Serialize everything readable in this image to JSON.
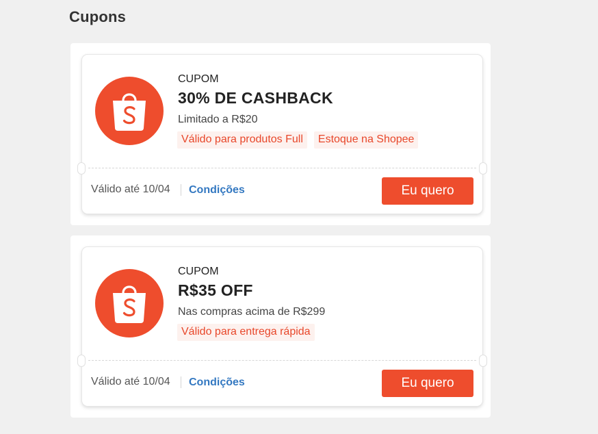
{
  "page": {
    "title": "Cupons"
  },
  "coupons": [
    {
      "icon": "shopee-bag-icon",
      "kind": "CUPOM",
      "headline": "30% DE CASHBACK",
      "subline": "Limitado a R$20",
      "tags": [
        "Válido para produtos Full",
        "Estoque na Shopee"
      ],
      "valid_until": "Válido até 10/04",
      "conditions_label": "Condições",
      "cta_label": "Eu quero"
    },
    {
      "icon": "shopee-bag-icon",
      "kind": "CUPOM",
      "headline": "R$35 OFF",
      "subline": "Nas compras acima de R$299",
      "tags": [
        "Válido para entrega rápida"
      ],
      "valid_until": "Válido até 10/04",
      "conditions_label": "Condições",
      "cta_label": "Eu quero"
    }
  ],
  "colors": {
    "accent": "#ee4d2d",
    "tag_bg": "#fdf1ee",
    "tag_text": "#e8472a",
    "link": "#3378c1"
  }
}
